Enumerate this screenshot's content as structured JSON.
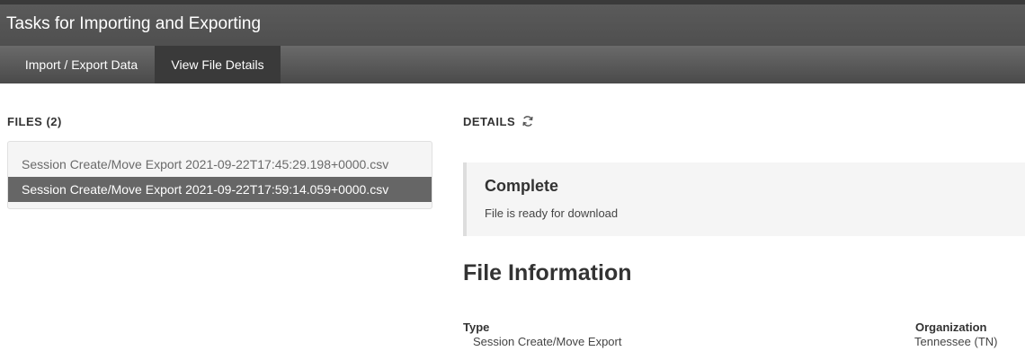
{
  "header": {
    "title": "Tasks for Importing and Exporting"
  },
  "tabs": [
    {
      "label": "Import / Export Data",
      "active": false
    },
    {
      "label": "View File Details",
      "active": true
    }
  ],
  "files": {
    "heading": "FILES (2)",
    "items": [
      {
        "name": "Session Create/Move Export 2021-09-22T17:45:29.198+0000.csv",
        "selected": false
      },
      {
        "name": "Session Create/Move Export 2021-09-22T17:59:14.059+0000.csv",
        "selected": true
      }
    ]
  },
  "details": {
    "heading": "DETAILS",
    "refresh_icon": "refresh-icon",
    "status_title": "Complete",
    "status_message": "File is ready for download"
  },
  "file_information": {
    "heading": "File Information",
    "type_label": "Type",
    "type_value": "Session Create/Move Export",
    "organization_label": "Organization",
    "organization_value": "Tennessee (TN)"
  },
  "colors": {
    "selected_row": "#666666",
    "header_bg": "#555555",
    "active_tab": "#3a3a3a"
  }
}
